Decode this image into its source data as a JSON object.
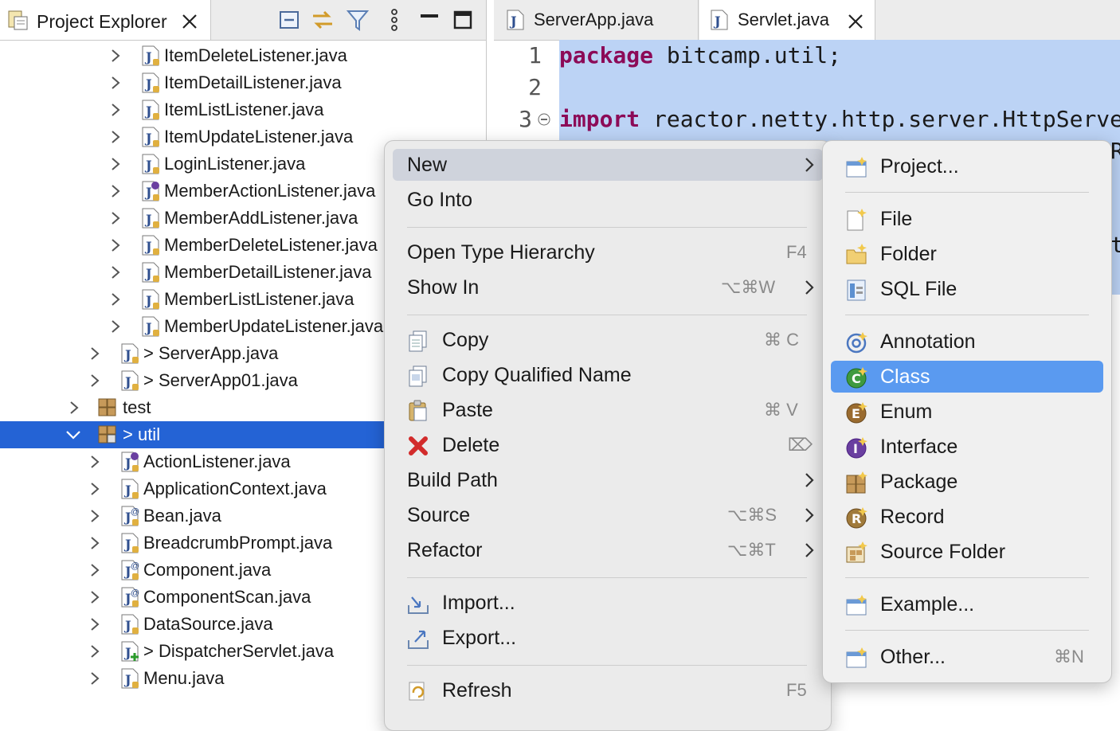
{
  "explorer": {
    "title": "Project Explorer",
    "rows": [
      {
        "label": "ItemDeleteListener.java"
      },
      {
        "label": "ItemDetailListener.java"
      },
      {
        "label": "ItemListListener.java"
      },
      {
        "label": "ItemUpdateListener.java"
      },
      {
        "label": "LoginListener.java"
      },
      {
        "label": "MemberActionListener.java"
      },
      {
        "label": "MemberAddListener.java"
      },
      {
        "label": "MemberDeleteListener.java"
      },
      {
        "label": "MemberDetailListener.java"
      },
      {
        "label": "MemberListListener.java"
      },
      {
        "label": "MemberUpdateListener.java"
      },
      {
        "label": "> ServerApp.java"
      },
      {
        "label": "> ServerApp01.java"
      },
      {
        "label": "test"
      },
      {
        "label": "> util"
      },
      {
        "label": "ActionListener.java"
      },
      {
        "label": "ApplicationContext.java"
      },
      {
        "label": "Bean.java"
      },
      {
        "label": "BreadcrumbPrompt.java"
      },
      {
        "label": "Component.java"
      },
      {
        "label": "ComponentScan.java"
      },
      {
        "label": "DataSource.java"
      },
      {
        "label": "> DispatcherServlet.java"
      },
      {
        "label": "Menu.java"
      }
    ]
  },
  "editor": {
    "tabs": [
      {
        "label": "ServerApp.java"
      },
      {
        "label": "Servlet.java"
      }
    ],
    "lines": [
      {
        "num": "1",
        "kw": "package",
        "rest": " bitcamp.util;"
      },
      {
        "num": "2",
        "kw": "",
        "rest": ""
      },
      {
        "num": "3",
        "kw": "import",
        "rest": " reactor.netty.http.server.HttpServerR"
      }
    ],
    "edge_chars": [
      "R",
      "t"
    ]
  },
  "context_menu": {
    "new": "New",
    "go_into": "Go Into",
    "open_type_hierarchy": "Open Type Hierarchy",
    "open_type_hierarchy_sc": "F4",
    "show_in": "Show In",
    "show_in_sc": "⌥⌘W",
    "copy": "Copy",
    "copy_sc": "⌘ C",
    "copy_qualified_name": "Copy Qualified Name",
    "paste": "Paste",
    "paste_sc": "⌘ V",
    "delete": "Delete",
    "delete_sc": "⌦",
    "build_path": "Build Path",
    "source": "Source",
    "source_sc": "⌥⌘S",
    "refactor": "Refactor",
    "refactor_sc": "⌥⌘T",
    "import": "Import...",
    "export": "Export...",
    "refresh": "Refresh",
    "refresh_sc": "F5"
  },
  "new_submenu": {
    "project": "Project...",
    "file": "File",
    "folder": "Folder",
    "sql_file": "SQL File",
    "annotation": "Annotation",
    "class": "Class",
    "enum": "Enum",
    "interface": "Interface",
    "package": "Package",
    "record": "Record",
    "source_folder": "Source Folder",
    "example": "Example...",
    "other": "Other...",
    "other_sc": "⌘N"
  },
  "colors": {
    "selection": "#2463d5",
    "menu_highlight": "#5a9af0",
    "code_selection": "#bcd3f5",
    "keyword": "#8c0a57"
  }
}
